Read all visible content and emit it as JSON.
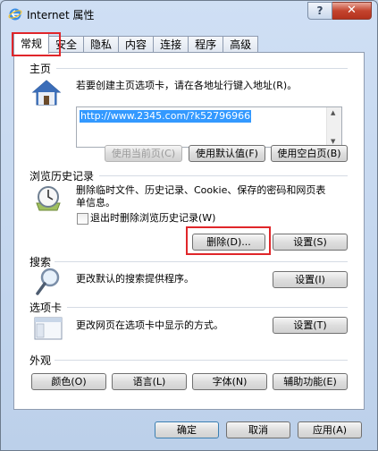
{
  "window": {
    "title": "Internet 属性",
    "help": "?",
    "close": "✕"
  },
  "tabs": [
    "常规",
    "安全",
    "隐私",
    "内容",
    "连接",
    "程序",
    "高级"
  ],
  "home": {
    "heading": "主页",
    "description": "若要创建主页选项卡，请在各地址行键入地址(R)。",
    "url": "http://www.2345.com/?k52796966",
    "btn_current": "使用当前页(C)",
    "btn_default": "使用默认值(F)",
    "btn_blank": "使用空白页(B)"
  },
  "history": {
    "heading": "浏览历史记录",
    "description": "删除临时文件、历史记录、Cookie、保存的密码和网页表单信息。",
    "checkbox": "退出时删除浏览历史记录(W)",
    "btn_delete": "删除(D)...",
    "btn_settings": "设置(S)"
  },
  "search": {
    "heading": "搜索",
    "description": "更改默认的搜索提供程序。",
    "btn_settings": "设置(I)"
  },
  "tabs_section": {
    "heading": "选项卡",
    "description": "更改网页在选项卡中显示的方式。",
    "btn_settings": "设置(T)"
  },
  "appearance": {
    "heading": "外观",
    "btn_colors": "颜色(O)",
    "btn_languages": "语言(L)",
    "btn_fonts": "字体(N)",
    "btn_accessibility": "辅助功能(E)"
  },
  "footer": {
    "ok": "确定",
    "cancel": "取消",
    "apply": "应用(A)"
  },
  "colors": {
    "red_highlight": "#e0262a",
    "url_selection": "#3399ff"
  }
}
